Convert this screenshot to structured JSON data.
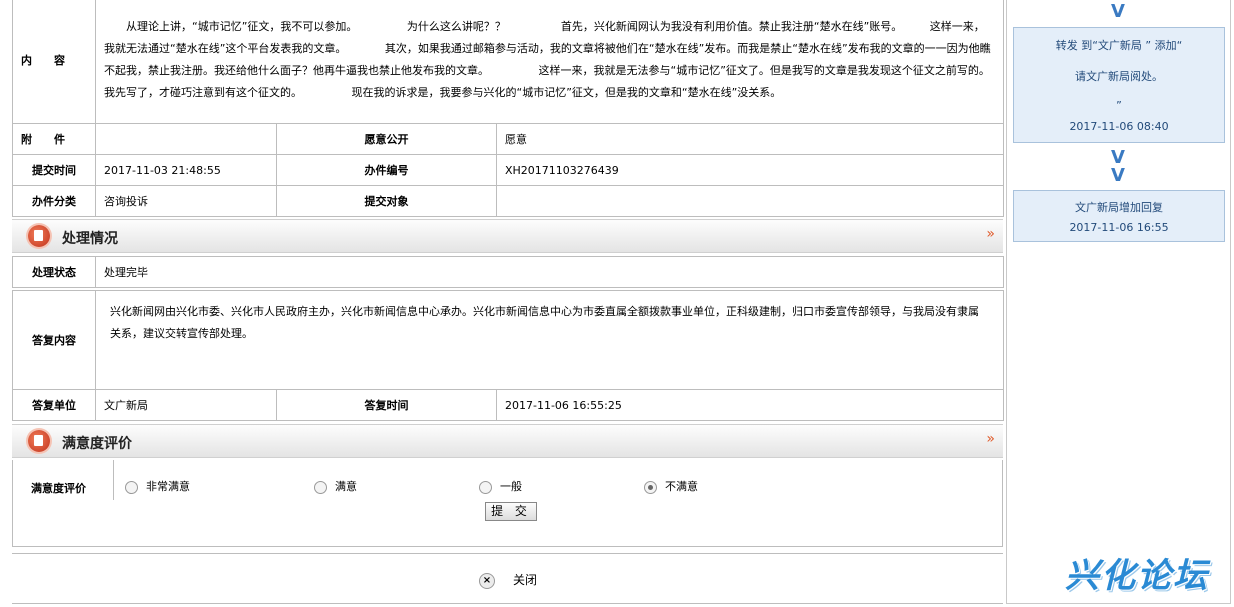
{
  "detail": {
    "content_label": "内　　容",
    "content_text": "　　从理论上讲，“城市记忆”征文，我不可以参加。　　　　　为什么这么讲呢？？　　　　　首先，兴化新闻网认为我没有利用价值。禁止我注册“楚水在线”账号。　　　这样一来，我就无法通过“楚水在线”这个平台发表我的文章。　　　　其次，如果我通过邮箱参与活动，我的文章将被他们在“楚水在线”发布。而我是禁止“楚水在线”发布我的文章的一一因为他瞧不起我，禁止我注册。我还给他什么面子？他再牛逼我也禁止他发布我的文章。　　　　　这样一来，我就是无法参与“城市记忆”征文了。但是我写的文章是我发现这个征文之前写的。我先写了，才碰巧注意到有这个征文的。　　　　　现在我的诉求是，我要参与兴化的“城市记忆”征文，但是我的文章和“楚水在线”没关系。",
    "attachment_label": "附　　件",
    "attachment_value": "",
    "public_label": "愿意公开",
    "public_value": "愿意",
    "submit_time_label": "提交时间",
    "submit_time_value": "2017-11-03 21:48:55",
    "case_no_label": "办件编号",
    "case_no_value": "XH20171103276439",
    "category_label": "办件分类",
    "category_value": "咨询投诉",
    "target_label": "提交对象",
    "target_value": ""
  },
  "processing": {
    "section_title": "处理情况",
    "more": "»",
    "status_label": "处理状态",
    "status_value": "处理完毕",
    "reply_label": "答复内容",
    "reply_text": "兴化新闻网由兴化市委、兴化市人民政府主办，兴化市新闻信息中心承办。兴化市新闻信息中心为市委直属全额拨款事业单位，正科级建制，归口市委宣传部领导，与我局没有隶属关系，建议交转宣传部处理。",
    "reply_unit_label": "答复单位",
    "reply_unit_value": "文广新局",
    "reply_time_label": "答复时间",
    "reply_time_value": "2017-11-06 16:55:25"
  },
  "rating": {
    "section_title": "满意度评价",
    "more": "»",
    "label": "满意度评价",
    "options": [
      "非常满意",
      "满意",
      "一般",
      "不满意"
    ],
    "selected": 3,
    "submit_label": "提 交"
  },
  "footer": {
    "close_label": "关闭",
    "close_icon": "×"
  },
  "sidebar": {
    "chevron": "V",
    "step1_line1": "转发 到“文广新局 ” 添加“",
    "step1_line2": "请文广新局阅处。",
    "step1_line3": "”",
    "step1_time": "2017-11-06 08:40",
    "step2_line1": "文广新局增加回复",
    "step2_time": "2017-11-06 16:55",
    "logo_text": "兴化论坛"
  }
}
